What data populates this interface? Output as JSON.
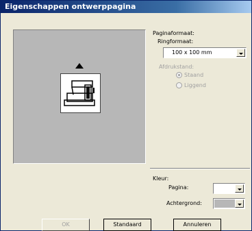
{
  "window": {
    "title": "Eigenschappen ontwerppagina"
  },
  "page_format": {
    "label": "Paginaformaat:",
    "ring_label": "Ringformaat:",
    "ring_value": "100 x 100 mm",
    "orientation_label": "Afdrukstand:",
    "orientation_options": [
      {
        "label": "Staand",
        "checked": true
      },
      {
        "label": "Liggend",
        "checked": false
      }
    ]
  },
  "color": {
    "label": "Kleur:",
    "page_label": "Pagina:",
    "page_color": "#ffffff",
    "background_label": "Achtergrond:",
    "background_color": "#b7b7b7"
  },
  "buttons": {
    "ok": "OK",
    "default": "Standaard",
    "cancel": "Annuleren"
  },
  "icons": {
    "preview_icon": "sewing-machine-icon",
    "up_arrow": "triangle-up-icon"
  }
}
